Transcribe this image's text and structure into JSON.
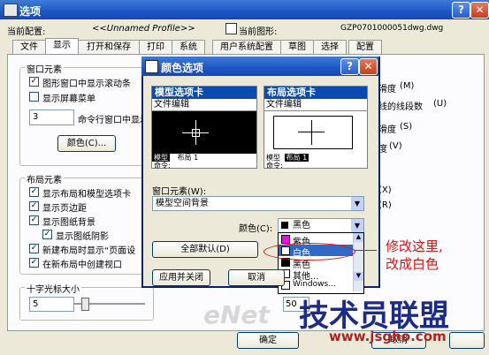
{
  "window": {
    "title": "选项",
    "help_btn": "?",
    "close_btn": "✕"
  },
  "profile": {
    "current_config_label": "当前配置:",
    "current_config_value": "<<Unnamed Profile>>",
    "current_drawing_label": "当前图形:",
    "current_drawing_value": "GZP0701000051dwg.dwg"
  },
  "tabs": [
    "文件",
    "显示",
    "打开和保存",
    "打印",
    "系统",
    "用户系统配置",
    "草图",
    "选择",
    "配置"
  ],
  "window_elements": {
    "title": "窗口元素",
    "items": [
      "图形窗口中显示滚动条",
      "显示屏幕菜单",
      "命令行窗口中显示"
    ],
    "lines_value": "3",
    "color_btn": "颜色(C)...",
    "right_labels": [
      "滑度",
      "线的线段数",
      "滑度",
      "度"
    ],
    "right_letters": [
      "(M)",
      "(U)",
      "(S)",
      "(V)"
    ]
  },
  "layout_elements": {
    "title": "布局元素",
    "items": [
      "显示布局和模型选项卡",
      "显示页边距",
      "显示图纸背景",
      "显示图纸阴影",
      "新建布局时显示“页面设",
      "在新布局中创建视口"
    ],
    "right_letters": [
      "(X)",
      "(R)"
    ]
  },
  "crosshair": {
    "title": "十字光标大小",
    "value": "5"
  },
  "bottom": {
    "ok": "确定",
    "cancel": "取消",
    "field_50": "50"
  },
  "dialog": {
    "title": "颜色选项",
    "help": "?",
    "close": "✕",
    "model_tab": "模型选项卡",
    "layout_tab": "布局选项卡",
    "text_edit": "文件编辑",
    "model_mini_tabs": [
      "模型",
      "布局 1"
    ],
    "layout_mini_tabs": [
      "模型",
      "布局 1"
    ],
    "command_label": "命令:",
    "window_element_label": "窗口元素(W):",
    "window_element_value": "模型空间背景",
    "color_label": "颜色(C):",
    "color_value": "黑色",
    "reset_btn": "全部默认(D)",
    "apply_btn": "应用并关闭",
    "cancel_btn": "取消",
    "color_options": [
      {
        "name": "紫色",
        "swatch": "#ff00ff"
      },
      {
        "name": "白色",
        "swatch": "#ffffff"
      },
      {
        "name": "黑色",
        "swatch": "#000000"
      },
      {
        "name": "其他...",
        "swatch": "#ffffff"
      },
      {
        "name": "Windows...",
        "swatch": "#ffffff"
      }
    ]
  },
  "annotation": {
    "line1": "修改这里,",
    "line2": "改成白色"
  },
  "watermark": {
    "brand": "技术员联盟",
    "url": "www.jsgho.com",
    "enet": "eNet"
  }
}
